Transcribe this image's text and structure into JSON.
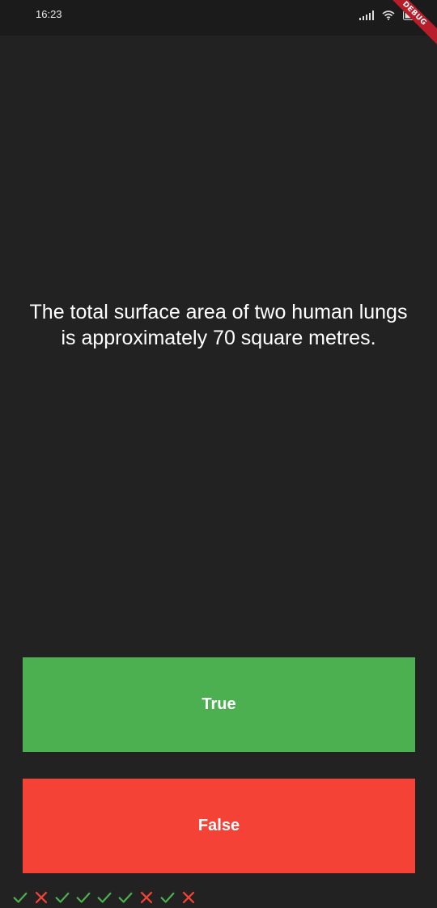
{
  "status_bar": {
    "time": "16:23",
    "icons": [
      "signal-icon",
      "wifi-icon",
      "battery-icon"
    ],
    "debug_label": "DEBUG"
  },
  "question": {
    "text": "The total surface area of two human lungs is approximately 70 square metres."
  },
  "buttons": {
    "true_label": "True",
    "false_label": "False"
  },
  "score_keeper": [
    "check",
    "cross",
    "check",
    "check",
    "check",
    "check",
    "cross",
    "check",
    "cross"
  ],
  "colors": {
    "background": "#222222",
    "true": "#4caf50",
    "false": "#f44336",
    "check_mark": "#4caf50",
    "cross_mark": "#f44336"
  }
}
